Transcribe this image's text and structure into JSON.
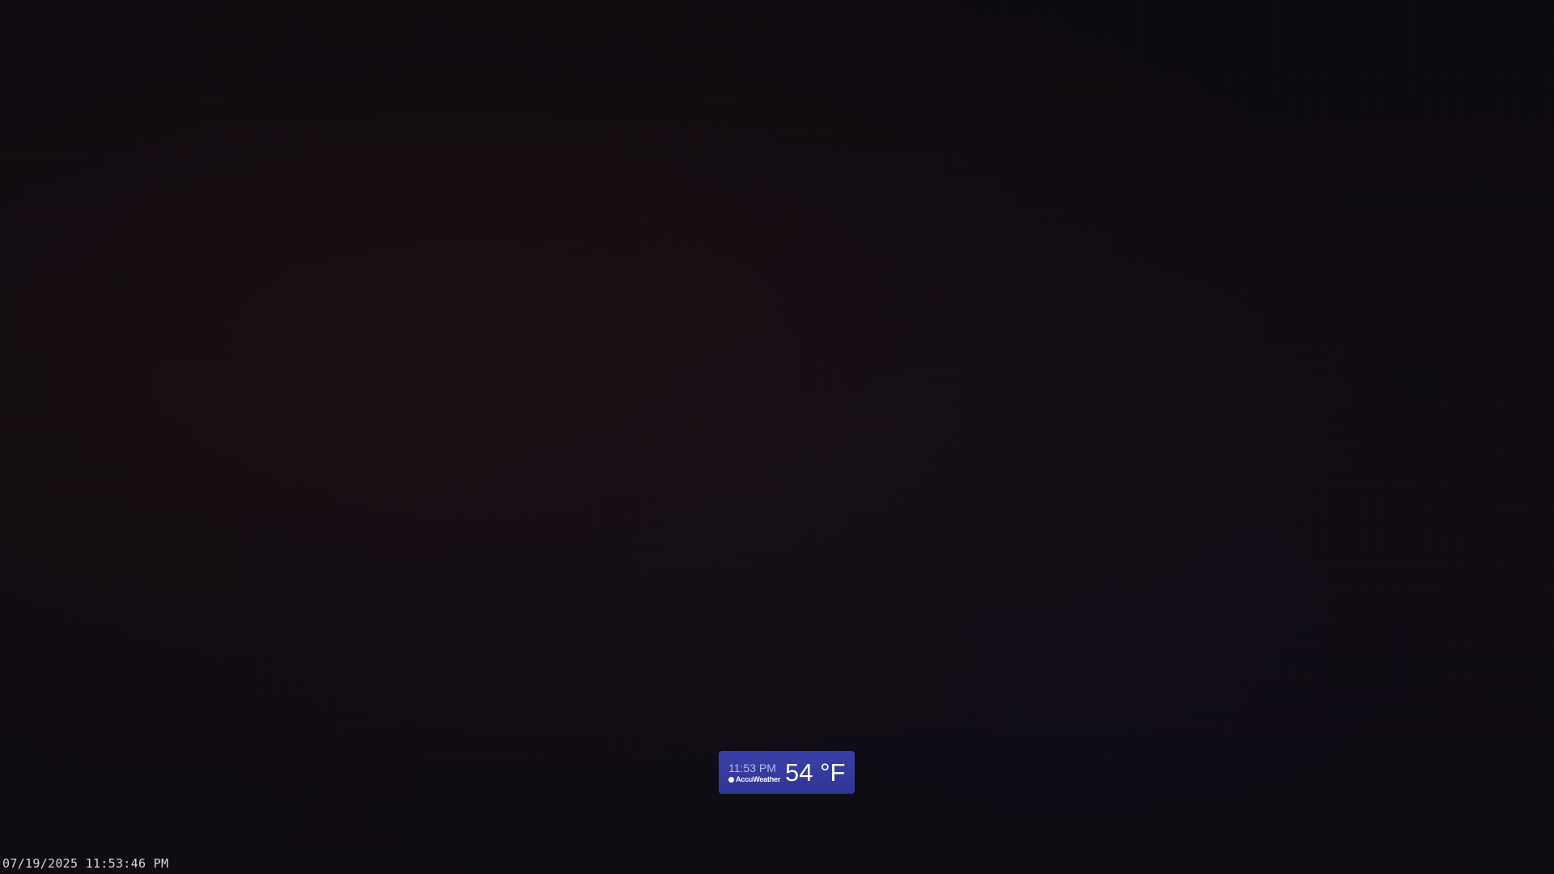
{
  "overlay": {
    "timestamp": "07/19/2025 11:53:46 PM"
  },
  "weather_widget": {
    "time": "11:53 PM",
    "brand": "AccuWeather",
    "brand_icon": "accuweather-sun-icon",
    "temperature": "54 °F",
    "background_color": "#3a3fa8"
  }
}
